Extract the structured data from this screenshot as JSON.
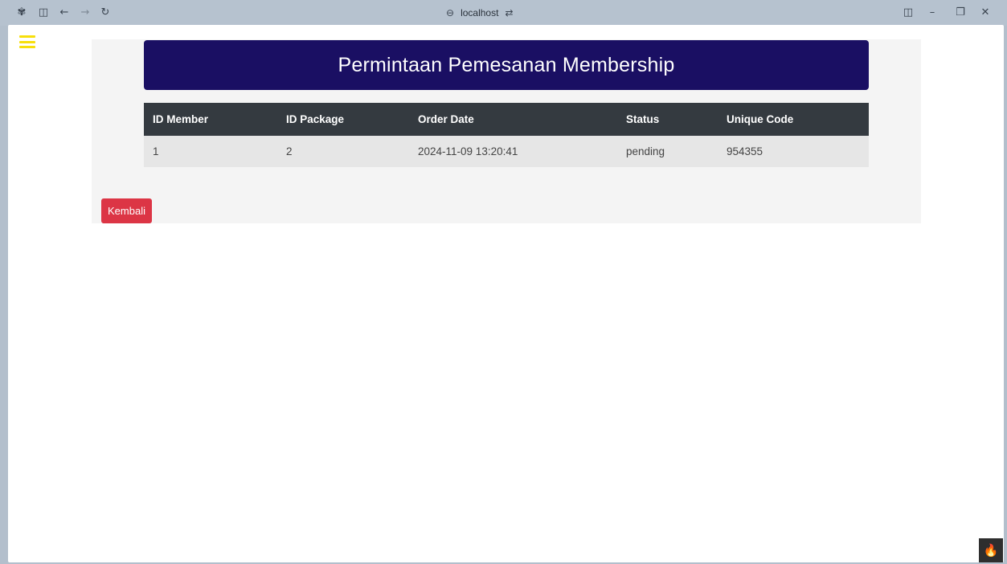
{
  "browser": {
    "address": "localhost",
    "icons": [
      "workspaces-icon",
      "sidebar-icon",
      "back-icon",
      "forward-icon",
      "reload-icon",
      "link-icon",
      "site-settings-icon",
      "split-view-icon",
      "minimize-icon",
      "restore-icon",
      "close-icon"
    ]
  },
  "page": {
    "title": "Permintaan Pemesanan Membership",
    "table": {
      "headers": [
        "ID Member",
        "ID Package",
        "Order Date",
        "Status",
        "Unique Code"
      ],
      "rows": [
        [
          "1",
          "2",
          "2024-11-09 13:20:41",
          "pending",
          "954355"
        ]
      ]
    },
    "back_label": "Kembali"
  },
  "colors": {
    "title_bg": "#1a0f63",
    "table_header_bg": "#343a40",
    "back_button": "#dc3545",
    "menu_icon": "#f7df0b"
  }
}
